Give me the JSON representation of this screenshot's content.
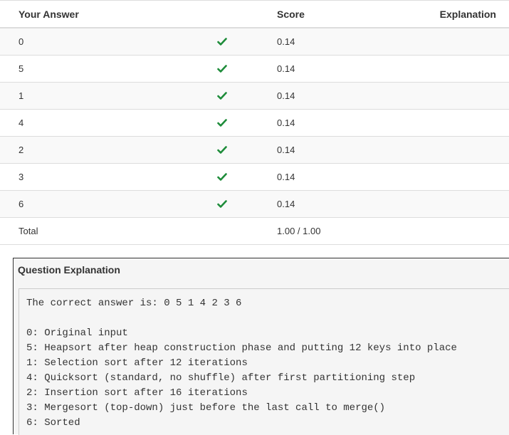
{
  "table": {
    "headers": {
      "answer": "Your Answer",
      "score": "Score",
      "explanation": "Explanation"
    },
    "rows": [
      {
        "answer": "0",
        "score": "0.14"
      },
      {
        "answer": "5",
        "score": "0.14"
      },
      {
        "answer": "1",
        "score": "0.14"
      },
      {
        "answer": "4",
        "score": "0.14"
      },
      {
        "answer": "2",
        "score": "0.14"
      },
      {
        "answer": "3",
        "score": "0.14"
      },
      {
        "answer": "6",
        "score": "0.14"
      }
    ],
    "total": {
      "label": "Total",
      "score": "1.00 / 1.00"
    },
    "check_icon": "check-icon",
    "check_color": "#1e8c3a"
  },
  "explanation": {
    "title": "Question Explanation",
    "correct": "The correct answer is: 0 5 1 4 2 3 6",
    "lines": [
      "0: Original input",
      "5: Heapsort after heap construction phase and putting 12 keys into place",
      "1: Selection sort after 12 iterations",
      "4: Quicksort (standard, no shuffle) after first partitioning step",
      "2: Insertion sort after 16 iterations",
      "3: Mergesort (top-down) just before the last call to merge()",
      "6: Sorted"
    ]
  }
}
